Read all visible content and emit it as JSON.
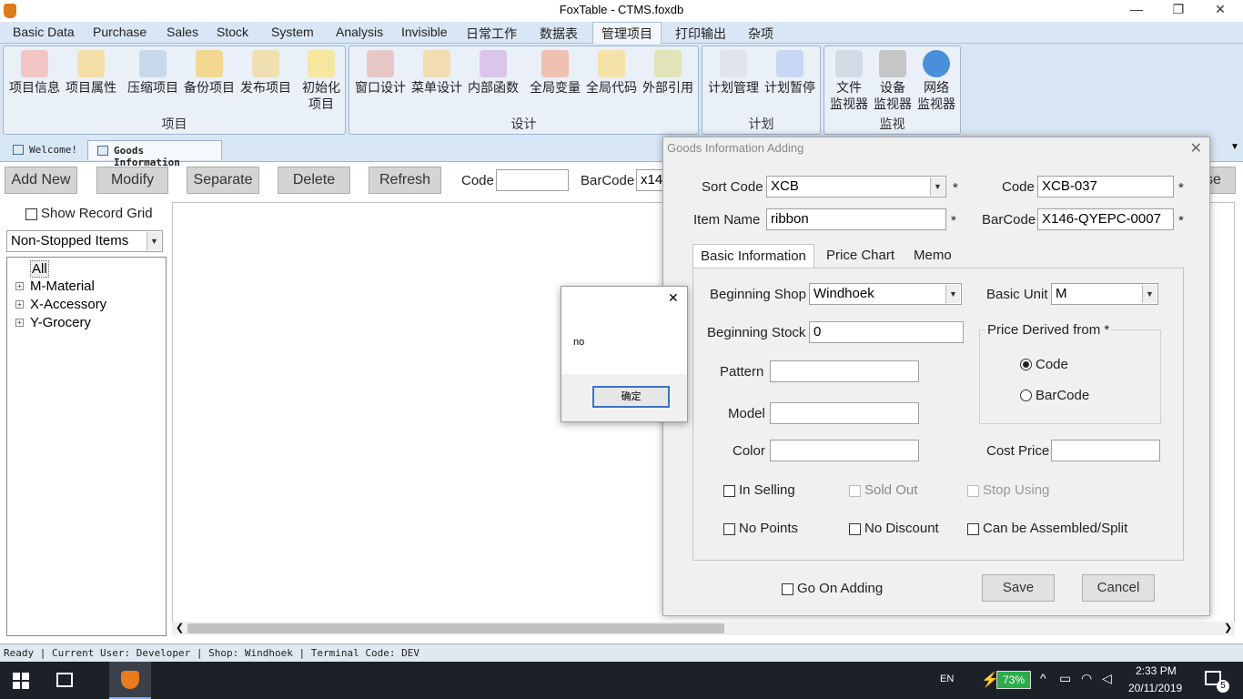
{
  "window": {
    "title": "FoxTable - CTMS.foxdb",
    "minimize": "—",
    "restore": "❐",
    "close": "✕"
  },
  "menu": [
    "Basic Data",
    "Purchase",
    "Sales",
    "Stock",
    "System",
    "Analysis",
    "Invisible",
    "日常工作",
    "数据表",
    "管理项目",
    "打印输出",
    "杂项"
  ],
  "ribbon": {
    "groups": [
      {
        "label": "项目",
        "buttons": [
          "项目信息",
          "项目属性",
          "压缩项目",
          "备份项目",
          "发布项目",
          "初始化\n项目"
        ]
      },
      {
        "label": "设计",
        "buttons": [
          "窗口设计",
          "菜单设计",
          "内部函数",
          "全局变量",
          "全局代码",
          "外部引用"
        ]
      },
      {
        "label": "计划",
        "buttons": [
          "计划管理",
          "计划暂停"
        ]
      },
      {
        "label": "监视",
        "buttons": [
          "文件\n监视器",
          "设备\n监视器",
          "网络\n监视器"
        ]
      }
    ]
  },
  "doc_tabs": [
    "Welcome!",
    "Goods Information"
  ],
  "toolbar": {
    "add_new": "Add New",
    "modify": "Modify",
    "separate": "Separate",
    "delete": "Delete",
    "refresh": "Refresh",
    "code_label": "Code",
    "code_value": "",
    "barcode_label": "BarCode",
    "barcode_value": "x14",
    "partial_button": "se"
  },
  "left_panel": {
    "show_record_grid": "Show Record Grid",
    "filter_value": "Non-Stopped Items",
    "tree": [
      "All",
      "M-Material",
      "X-Accessory",
      "Y-Grocery"
    ]
  },
  "statusbar": "Ready | Current User: Developer | Shop: Windhoek | Terminal Code: DEV",
  "taskbar": {
    "lang": "EN",
    "battery": "73%",
    "time": "2:33 PM",
    "date": "20/11/2019",
    "notifications": "5"
  },
  "dialog": {
    "title": "Goods Information Adding",
    "sort_code_label": "Sort Code",
    "sort_code_value": "XCB",
    "code_label": "Code",
    "code_value": "XCB-037",
    "item_name_label": "Item Name",
    "item_name_value": "ribbon",
    "barcode_label": "BarCode",
    "barcode_value": "X146-QYEPC-0007",
    "required_mark": "*",
    "tabs": [
      "Basic Information",
      "Price Chart",
      "Memo"
    ],
    "beginning_shop_label": "Beginning Shop",
    "beginning_shop_value": "Windhoek",
    "basic_unit_label": "Basic Unit",
    "basic_unit_value": "M",
    "beginning_stock_label": "Beginning Stock",
    "beginning_stock_value": "0",
    "price_derived_label": "Price Derived from *",
    "radio_code": "Code",
    "radio_barcode": "BarCode",
    "pattern_label": "Pattern",
    "model_label": "Model",
    "color_label": "Color",
    "cost_price_label": "Cost Price",
    "checks": [
      "In Selling",
      "Sold Out",
      "Stop Using",
      "No Points",
      "No Discount",
      "Can be Assembled/Split"
    ],
    "go_on_adding": "Go On Adding",
    "save": "Save",
    "cancel": "Cancel"
  },
  "msgbox": {
    "text": "no",
    "ok": "确定",
    "close": "✕"
  }
}
